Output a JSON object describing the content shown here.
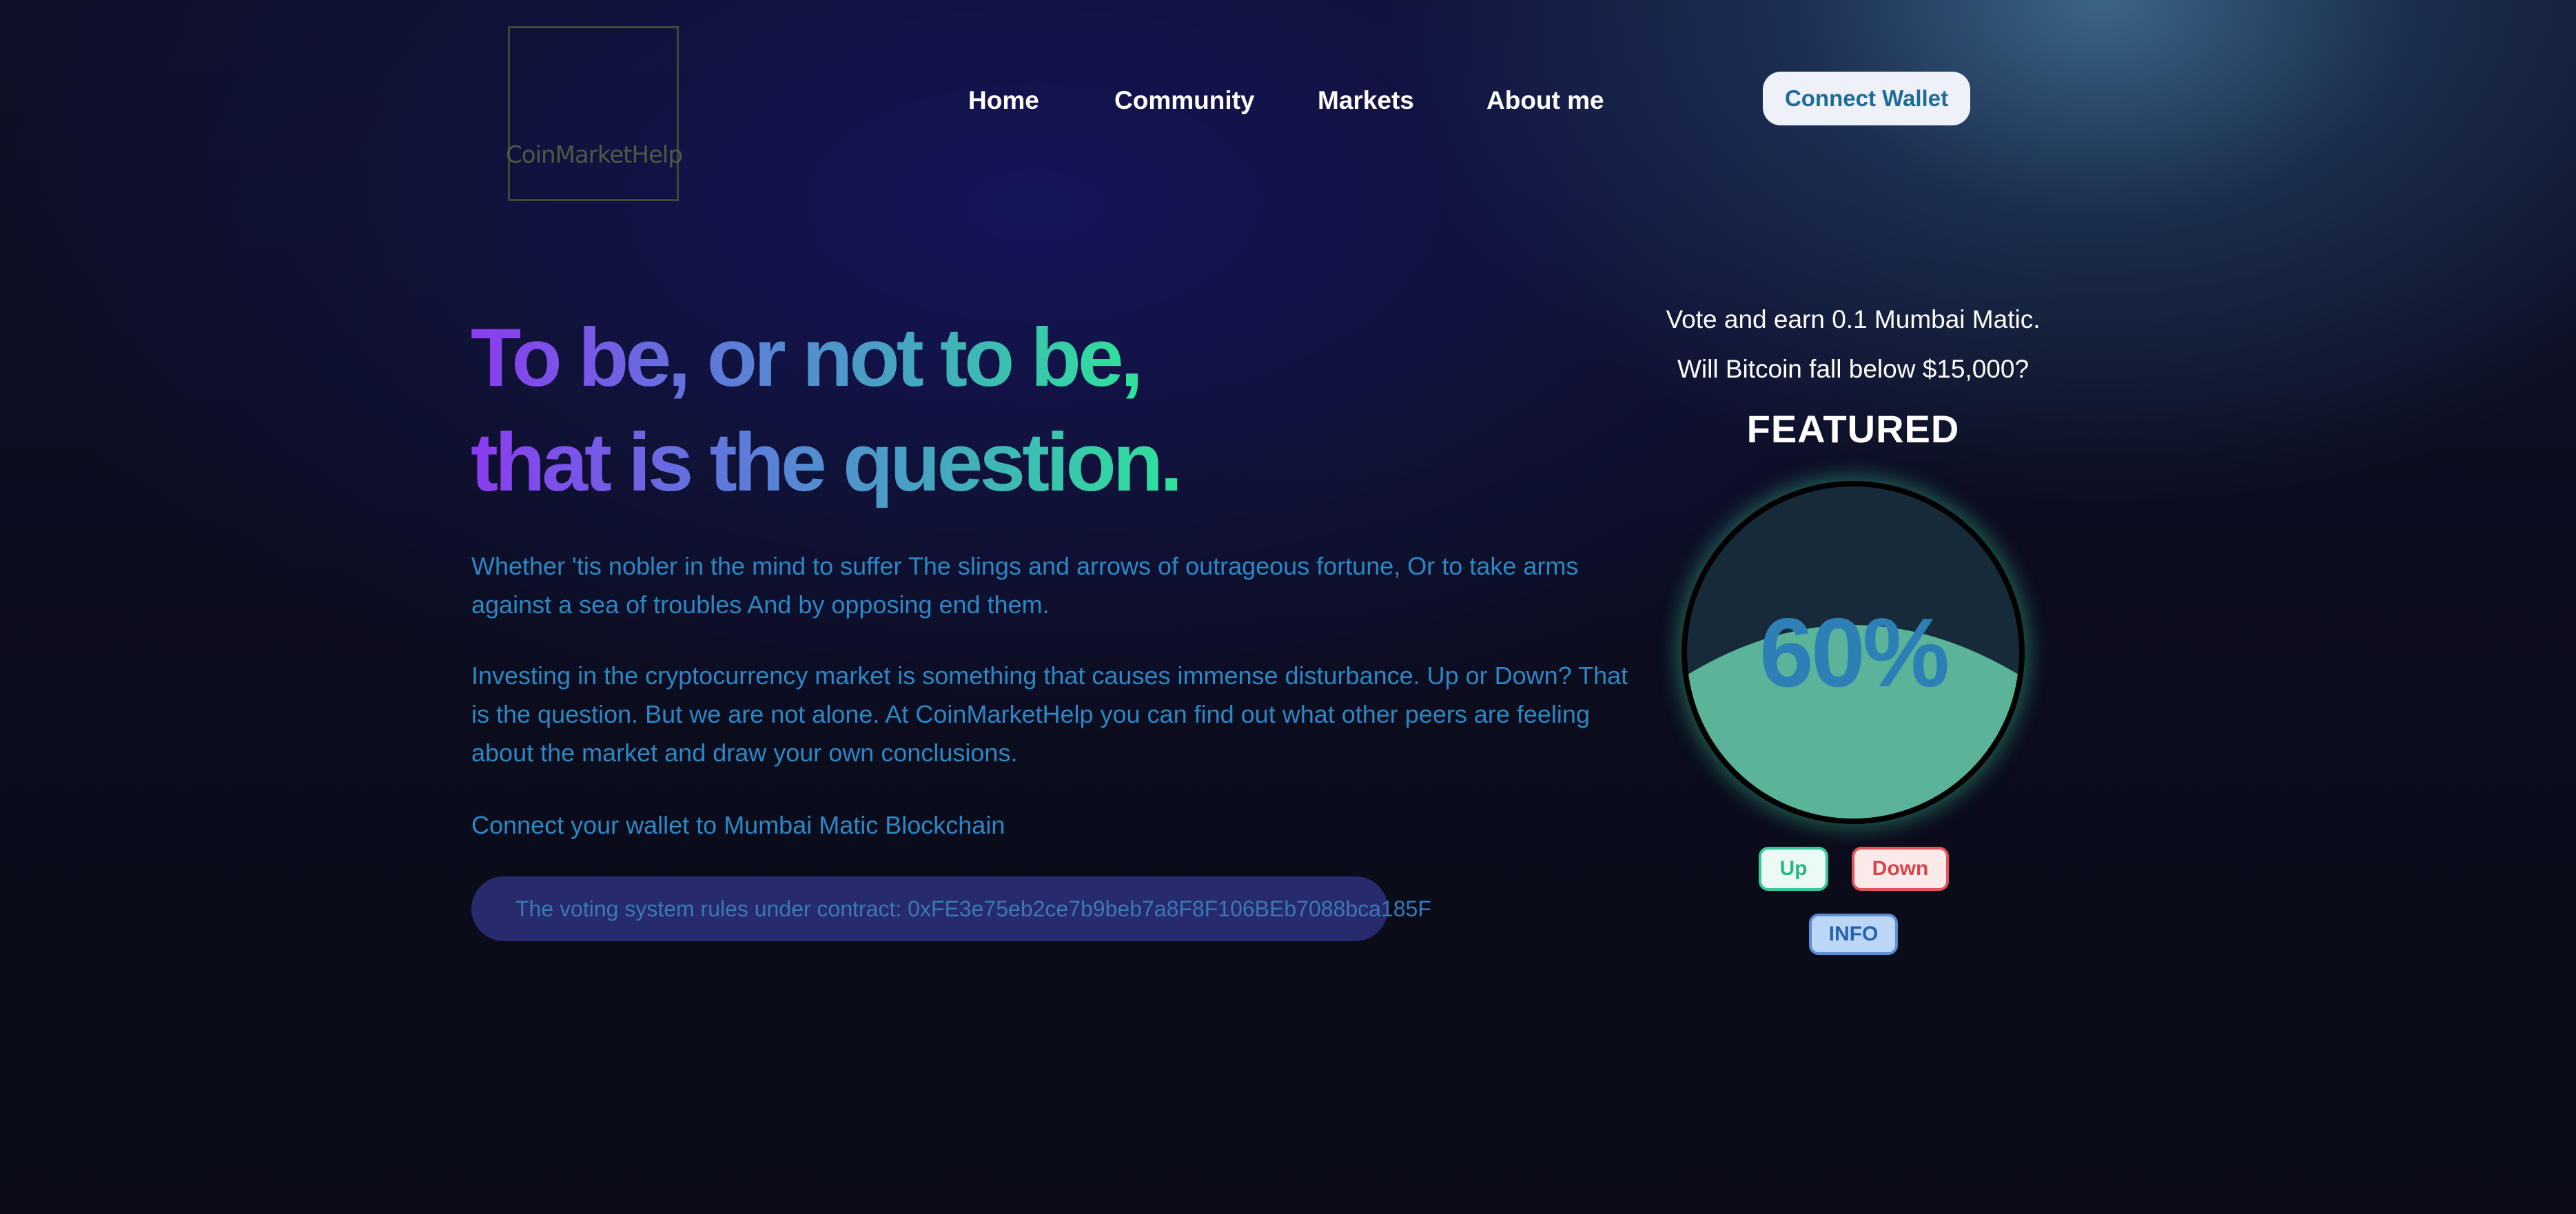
{
  "brand": {
    "logo_text": "CoinMarketHelp"
  },
  "nav": {
    "home": "Home",
    "community": "Community",
    "markets": "Markets",
    "about": "About me",
    "connect_wallet": "Connect Wallet"
  },
  "hero": {
    "title_line1": "To be, or not to be,",
    "title_line2": "that is the question.",
    "paragraph1": "Whether 'tis nobler in the mind to suffer The slings and arrows of outrageous fortune, Or to take arms against a sea of troubles And by opposing end them.",
    "paragraph2": "Investing in the cryptocurrency market is something that causes immense disturbance. Up or Down? That is the question. But we are not alone. At CoinMarketHelp you can find out what other peers are feeling about the market and draw your own conclusions.",
    "paragraph3": "Connect your wallet to Mumbai Matic Blockchain",
    "contract_text": "The voting system rules under contract: 0xFE3e75eb2ce7b9beb7a8F8F106BEb7088bca185F"
  },
  "poll": {
    "reward_text": "Vote and earn 0.1 Mumbai Matic.",
    "question": "Will Bitcoin fall below $15,000?",
    "featured_label": "FEATURED",
    "percent_text": "60%",
    "fill_level": 0.6,
    "up_label": "Up",
    "down_label": "Down",
    "info_label": "INFO"
  },
  "colors": {
    "gauge_fill": "#5bb39a",
    "gauge_glow": "#3cc896",
    "up_accent": "#37c79b",
    "down_accent": "#e0545a",
    "info_accent": "#5a8ed6"
  }
}
